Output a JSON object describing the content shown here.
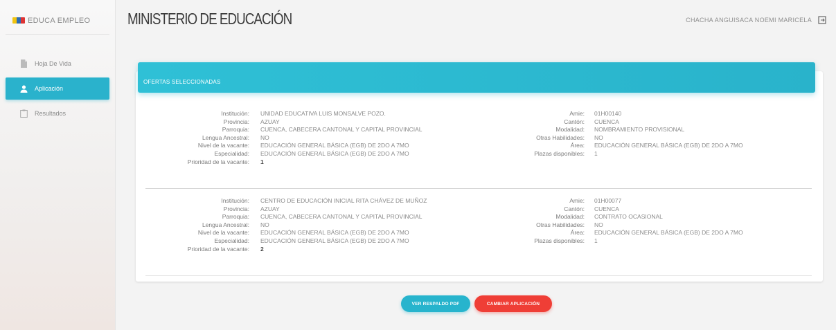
{
  "brand": {
    "name": "EDUCA EMPLEO",
    "logo_icon": "ministry-logo-icon"
  },
  "sidebar": {
    "items": [
      {
        "label": "Hoja De Vida",
        "icon": "document-icon",
        "active": false
      },
      {
        "label": "Aplicación",
        "icon": "user-icon",
        "active": true
      },
      {
        "label": "Resultados",
        "icon": "clipboard-icon",
        "active": false
      }
    ]
  },
  "header": {
    "title": "MINISTERIO DE EDUCACIÓN",
    "user": "CHACHA ANGUISACA NOEMI MARICELA",
    "logout_icon": "logout-icon"
  },
  "card": {
    "title": "OFERTAS SELECCIONADAS"
  },
  "labels": {
    "institucion": "Institución:",
    "provincia": "Provincia:",
    "parroquia": "Parroquia:",
    "lengua": "Lengua Ancestral:",
    "nivel": "Nivel de la vacante:",
    "especialidad": "Especialidad:",
    "prioridad": "Prioridad de la vacante:",
    "amie": "Amie:",
    "canton": "Cantón:",
    "modalidad": "Modalidad:",
    "otras": "Otras Habilidades:",
    "area": "Área:",
    "plazas": "Plazas disponibles:"
  },
  "offers": [
    {
      "institucion": "UNIDAD EDUCATIVA LUIS MONSALVE POZO.",
      "provincia": "AZUAY",
      "parroquia": "CUENCA, CABECERA CANTONAL Y CAPITAL PROVINCIAL",
      "lengua": "NO",
      "nivel": "EDUCACIÓN GENERAL BÁSICA (EGB) DE 2DO A 7MO",
      "especialidad": "EDUCACIÓN GENERAL BÁSICA (EGB) DE 2DO A 7MO",
      "prioridad": "1",
      "amie": "01H00140",
      "canton": "CUENCA",
      "modalidad": "NOMBRAMIENTO PROVISIONAL",
      "otras": "NO",
      "area": "EDUCACIÓN GENERAL BÁSICA (EGB) DE 2DO A 7MO",
      "plazas": "1"
    },
    {
      "institucion": "CENTRO DE EDUCACIÓN INICIAL RITA CHÁVEZ DE MUÑOZ",
      "provincia": "AZUAY",
      "parroquia": "CUENCA, CABECERA CANTONAL Y CAPITAL PROVINCIAL",
      "lengua": "NO",
      "nivel": "EDUCACIÓN GENERAL BÁSICA (EGB) DE 2DO A 7MO",
      "especialidad": "EDUCACIÓN GENERAL BÁSICA (EGB) DE 2DO A 7MO",
      "prioridad": "2",
      "amie": "01H00077",
      "canton": "CUENCA",
      "modalidad": "CONTRATO OCASIONAL",
      "otras": "NO",
      "area": "EDUCACIÓN GENERAL BÁSICA (EGB) DE 2DO A 7MO",
      "plazas": "1"
    }
  ],
  "actions": {
    "pdf_label": "VER RESPALDO PDF",
    "change_label": "CAMBIAR APLICACIÓN"
  },
  "colors": {
    "accent": "#2ab2cc",
    "danger": "#ef3e36",
    "title": "#3c3c3c"
  }
}
